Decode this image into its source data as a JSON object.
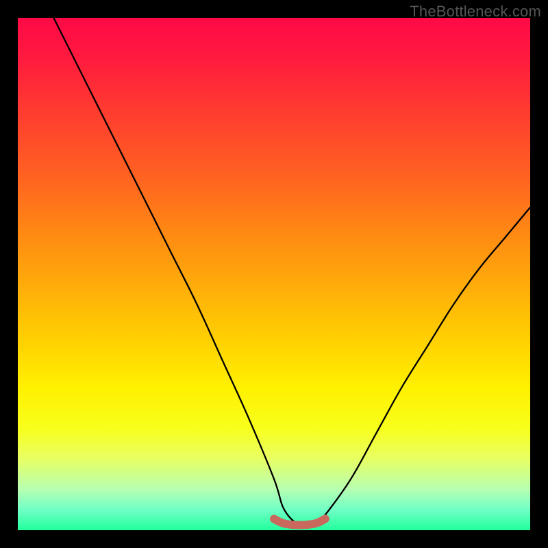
{
  "watermark": "TheBottleneck.com",
  "chart_data": {
    "type": "line",
    "title": "",
    "xlabel": "",
    "ylabel": "",
    "x_range": [
      0,
      100
    ],
    "y_range": [
      0,
      100
    ],
    "grid": false,
    "legend": false,
    "series": [
      {
        "name": "bottleneck-curve",
        "x": [
          7,
          10,
          15,
          20,
          25,
          30,
          35,
          40,
          45,
          50,
          52,
          55,
          58,
          60,
          65,
          70,
          75,
          80,
          85,
          90,
          95,
          100
        ],
        "y": [
          100,
          94,
          84,
          74,
          64,
          54,
          44,
          33,
          22,
          10,
          4,
          1,
          1,
          3,
          10,
          19,
          28,
          36,
          44,
          51,
          57,
          63
        ],
        "color": "#000000"
      },
      {
        "name": "optimal-range-marker",
        "x": [
          50,
          52,
          55,
          58,
          60
        ],
        "y": [
          2.2,
          1.3,
          1.0,
          1.3,
          2.2
        ],
        "color": "#c9695d"
      }
    ],
    "background_gradient": {
      "type": "vertical-linear",
      "stops": [
        {
          "pos": 0.0,
          "color": "#ff0947"
        },
        {
          "pos": 0.3,
          "color": "#ff5f22"
        },
        {
          "pos": 0.64,
          "color": "#ffd401"
        },
        {
          "pos": 0.8,
          "color": "#f8ff1b"
        },
        {
          "pos": 1.0,
          "color": "#20ff9c"
        }
      ]
    }
  }
}
